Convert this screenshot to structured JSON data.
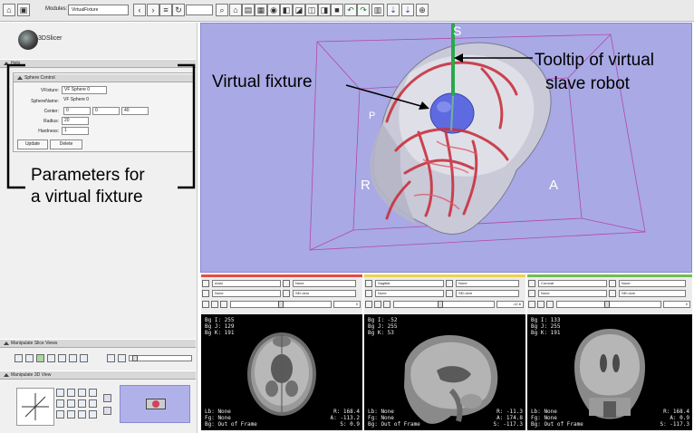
{
  "toolbar": {
    "modules_label": "Modules:",
    "module_selected": "VirtualFixture"
  },
  "app": {
    "logo_text": "3DSlicer"
  },
  "left_panel": {
    "help_label": "Help",
    "sphere_control": {
      "title": "Sphere Control",
      "vfixture_label": "VFixture:",
      "vfixture_value": "VF Sphere 0",
      "spherename_label": "SphereName:",
      "spherename_value": "VF Sphere 0",
      "center_label": "Center:",
      "center_x": "0",
      "center_y": "0",
      "center_z": "40",
      "radius_label": "Radius:",
      "radius_value": "20",
      "hardness_label": "Hardness:",
      "hardness_value": "1",
      "update_label": "Update",
      "delete_label": "Delete"
    },
    "manip_slice_title": "Manipulate Slice Views",
    "manip_3d_title": "Manipulate 3D View"
  },
  "annotations": {
    "params_line1": "Parameters for",
    "params_line2": "a virtual fixture",
    "vf_label": "Virtual fixture",
    "tooltip_line1": "Tooltip of virtual",
    "tooltip_line2": "slave robot"
  },
  "view3d": {
    "axis_s": "S",
    "axis_r": "R",
    "axis_a": "A",
    "axis_p": "P"
  },
  "slices": [
    {
      "name": "Axial",
      "color": "#e64b46",
      "fg_sel": "None",
      "bg_sel": "None",
      "lb_sel": "SEI.dcm",
      "offset": "0",
      "top_left": "Bg I: 255\nBg J: 129\nBg K: 191",
      "bottom_left": "Lb: None\nFg: None\nBg: Out of Frame",
      "bottom_right": "R: 168.4\nA: -113.2\nS: 0.9"
    },
    {
      "name": "Sagittal",
      "color": "#e8d54a",
      "fg_sel": "None",
      "bg_sel": "None",
      "lb_sel": "SEI.dcm",
      "offset": "-12.6",
      "top_left": "Bg I: -52\nBg J: 255\nBg K: 53",
      "bottom_left": "Lb: None\nFg: None\nBg: Out of Frame",
      "bottom_right": "R: -11.3\nA: 174.8\nS: -117.3"
    },
    {
      "name": "Coronal",
      "color": "#6fbf4f",
      "fg_sel": "None",
      "bg_sel": "None",
      "lb_sel": "SEI.dcm",
      "offset": "0",
      "top_left": "Bg I: 133\nBg J: 255\nBg K: 191",
      "bottom_left": "Lb: None\nFg: None\nBg: Out of Frame",
      "bottom_right": "R: 168.4\nA: 0.9\nS: -117.3"
    }
  ]
}
